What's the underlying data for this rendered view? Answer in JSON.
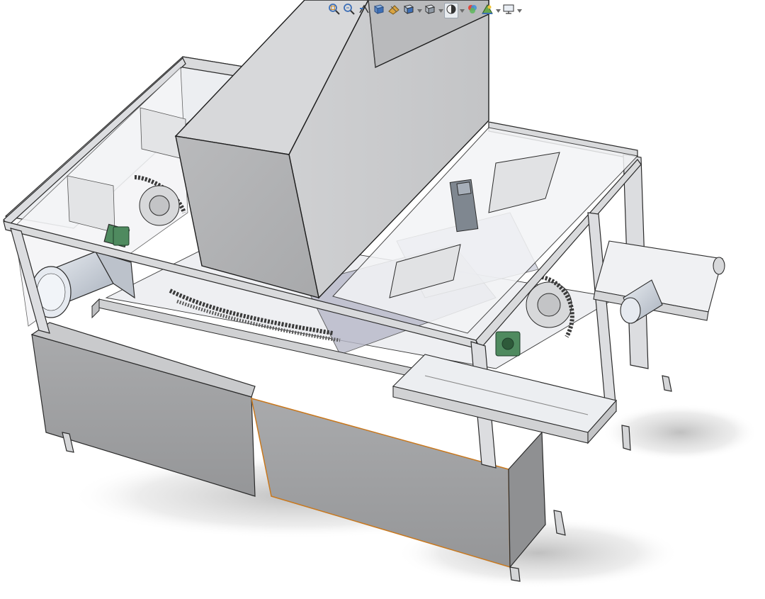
{
  "toolbar": {
    "buttons": [
      {
        "name": "zoom-to-fit",
        "icon": "zoom-to-fit-icon"
      },
      {
        "name": "zoom-to-area",
        "icon": "zoom-area-icon"
      },
      {
        "name": "previous-view",
        "icon": "previous-view-icon"
      },
      {
        "name": "section-view",
        "icon": "section-view-icon"
      },
      {
        "name": "dynamic-annotation-views",
        "icon": "annotation-view-icon"
      },
      {
        "name": "view-orientation",
        "icon": "view-orientation-icon",
        "dropdown": true
      },
      {
        "name": "display-style",
        "icon": "display-style-icon",
        "dropdown": true
      },
      {
        "name": "hide-show-items",
        "icon": "hide-show-icon",
        "dropdown": true,
        "active": true
      },
      {
        "name": "edit-appearance",
        "icon": "edit-appearance-icon"
      },
      {
        "name": "apply-scene",
        "icon": "apply-scene-icon",
        "dropdown": true
      },
      {
        "name": "view-settings",
        "icon": "monitor-icon",
        "dropdown": true
      }
    ]
  },
  "model": {
    "description_colors": {
      "frame": "#d9dadc",
      "frame_edge": "#2b2b2b",
      "hopper": "#c2c3c5",
      "panel": "#9d9ea0",
      "glass": "#eef0f3",
      "selection_edge": "#c8781e",
      "bearing_green": "#4f8a5f",
      "motor": "#b8c0cc"
    }
  }
}
